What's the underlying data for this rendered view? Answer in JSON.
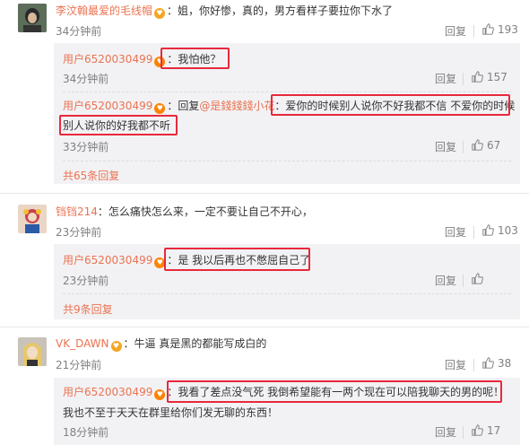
{
  "comments": [
    {
      "user": "李汶翰最爱的毛线帽",
      "text": "：姐，你好惨，真的，男方看样子要拉你下水了",
      "time": "34分钟前",
      "reply_label": "回复",
      "likes": "193"
    },
    {
      "user": "铛铛214",
      "text": "：怎么痛快怎么来，一定不要让自己不开心，",
      "time": "23分钟前",
      "reply_label": "回复",
      "likes": "103"
    },
    {
      "user": "VK_DAWN",
      "text": "：牛逼 真是黑的都能写成白的",
      "time": "21分钟前",
      "reply_label": "回复",
      "likes": "38"
    }
  ],
  "replies": [
    {
      "user": "用户6520030499",
      "text": "：我怕他？",
      "time": "34分钟前",
      "reply_label": "回复",
      "likes": "157"
    },
    {
      "user": "用户6520030499",
      "text_prefix": "：回复",
      "mention": "@是錢錢錢小花",
      "text": "：爱你的时候别人说你不好我都不信 不爱你的时候",
      "text_line2": "别人说你的好我都不听",
      "time": "33分钟前",
      "reply_label": "回复",
      "likes": "67"
    },
    {
      "user": "用户6520030499",
      "text": "：是 我以后再也不憋屈自己了",
      "time": "23分钟前",
      "reply_label": "回复",
      "likes": "0"
    },
    {
      "user": "用户6520030499",
      "text": "：我看了差点没气死 我倒希望能有一两个现在可以陪我聊天的男的呢！",
      "text_line2": "我也不至于天天在群里给你们发无聊的东西！",
      "time": "18分钟前",
      "reply_label": "回复",
      "likes": "17"
    }
  ],
  "more_links": [
    "共65条回复",
    "共9条回复"
  ],
  "colors": {
    "user": "#eb7350",
    "highlight": "#e8293b",
    "reply_bg": "#f2f2f5"
  }
}
